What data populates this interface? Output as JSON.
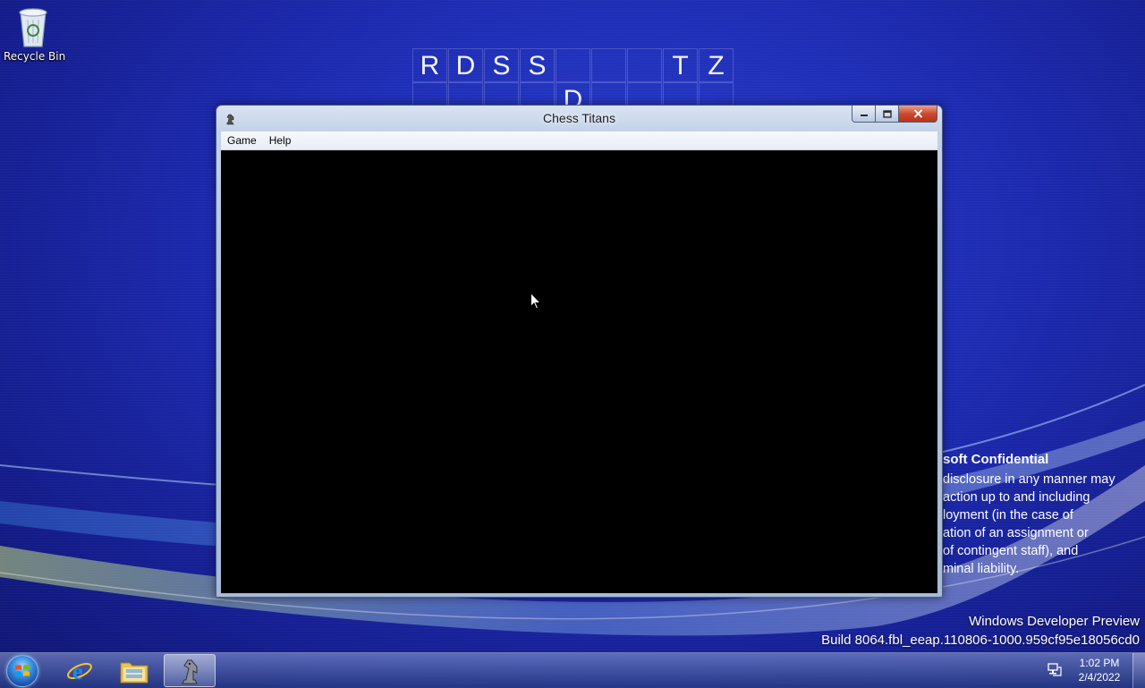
{
  "desktop": {
    "icons": [
      {
        "label": "Recycle Bin",
        "icon": "recycle-bin-icon"
      }
    ],
    "word_grid": {
      "row1": [
        "R",
        "D",
        "S",
        "S",
        "",
        "",
        "",
        "T",
        "Z"
      ],
      "row2": [
        "",
        "",
        "",
        "",
        "D",
        "",
        "",
        "",
        ""
      ]
    },
    "confidential": {
      "heading": "soft Confidential",
      "lines": [
        "disclosure in any manner may",
        "action up to and including",
        "loyment (in the case of",
        "ation of an assignment or",
        "of contingent staff), and",
        "minal liability."
      ]
    },
    "build_info": {
      "line1": "Windows Developer Preview",
      "line2": "Build 8064.fbl_eeap.110806-1000.959cf95e18056cd0"
    }
  },
  "window": {
    "title": "Chess Titans",
    "app_icon": "chess-knight-icon",
    "menu": [
      "Game",
      "Help"
    ],
    "controls": {
      "minimize": "minimize-icon",
      "maximize": "maximize-icon",
      "close": "close-icon"
    }
  },
  "taskbar": {
    "start_icon": "windows-logo-icon",
    "pinned": [
      {
        "name": "Internet Explorer",
        "icon": "internet-explorer-icon"
      },
      {
        "name": "Windows Explorer",
        "icon": "folder-icon"
      },
      {
        "name": "Chess Titans",
        "icon": "chess-knight-icon",
        "active": true
      }
    ],
    "tray": {
      "network_icon": "network-icon"
    },
    "clock": {
      "time": "1:02 PM",
      "date": "2/4/2022"
    }
  }
}
